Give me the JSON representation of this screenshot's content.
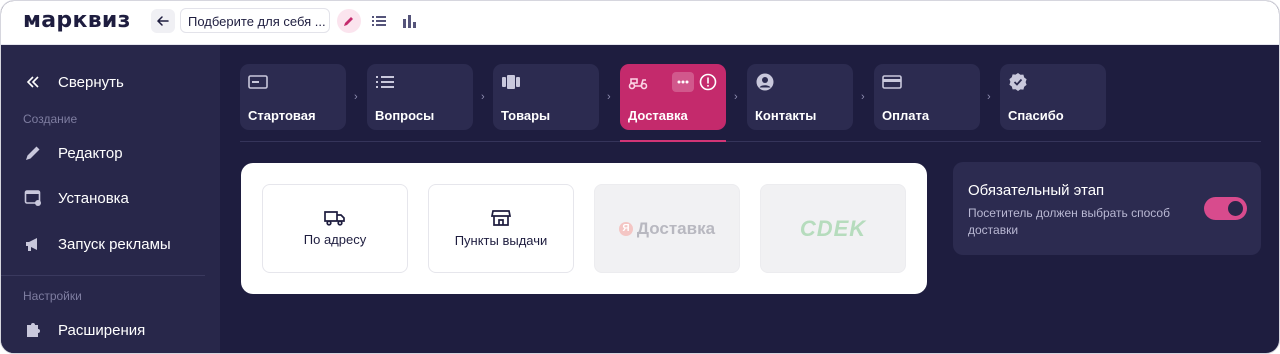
{
  "brand": {
    "logo": "марквиз",
    "accent": "#c42a6c",
    "bg": "#1e1d3f"
  },
  "topbar": {
    "title_value": "Подберите для себя ...",
    "icons": [
      "back-arrow-icon",
      "pencil-icon",
      "list-icon",
      "bar-chart-icon"
    ]
  },
  "sidebar": {
    "collapse_label": "Свернуть",
    "section_create": "Создание",
    "items_create": [
      {
        "label": "Редактор",
        "icon": "pencil-icon"
      },
      {
        "label": "Установка",
        "icon": "install-icon"
      },
      {
        "label": "Запуск рекламы",
        "icon": "megaphone-icon"
      }
    ],
    "section_settings": "Настройки",
    "items_settings": [
      {
        "label": "Расширения",
        "icon": "puzzle-icon"
      }
    ]
  },
  "steps": [
    {
      "label": "Стартовая",
      "icon": "start-screen-icon"
    },
    {
      "label": "Вопросы",
      "icon": "list-icon"
    },
    {
      "label": "Товары",
      "icon": "products-icon"
    },
    {
      "label": "Доставка",
      "icon": "scooter-icon",
      "active": true
    },
    {
      "label": "Контакты",
      "icon": "user-circle-icon"
    },
    {
      "label": "Оплата",
      "icon": "card-icon"
    },
    {
      "label": "Спасибо",
      "icon": "badge-check-icon"
    }
  ],
  "step_chevron": "›",
  "delivery_options": [
    {
      "label": "По адресу",
      "icon": "truck-icon"
    },
    {
      "label": "Пункты выдачи",
      "icon": "store-icon"
    },
    {
      "label": "Доставка",
      "brand": "Я",
      "disabled": true
    },
    {
      "label": "CDEK",
      "disabled": true
    }
  ],
  "required_panel": {
    "title": "Обязательный этап",
    "description": "Посетитель должен выбрать способ доставки",
    "toggle_on": true
  }
}
